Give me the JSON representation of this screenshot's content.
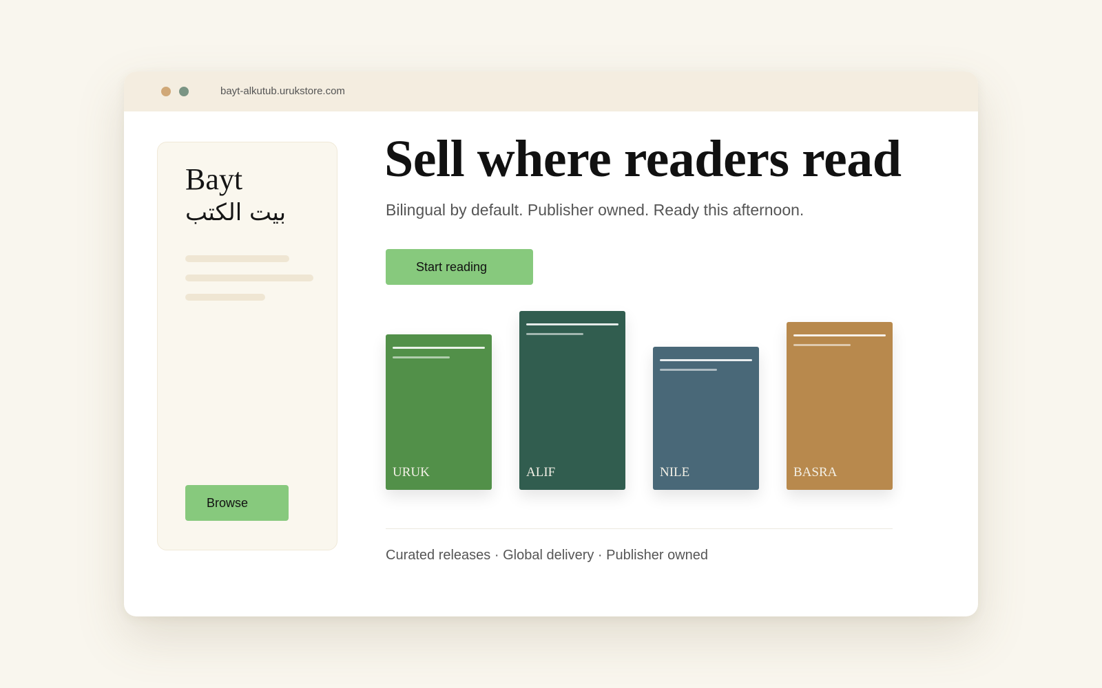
{
  "browser": {
    "url": "bayt-alkutub.urukstore.com",
    "dot_colors": [
      "#f4ede0",
      "#d0a878",
      "#7a9484"
    ]
  },
  "sidebar": {
    "brand": "Bayt",
    "brand_arabic": "بيت الكتب",
    "browse_label": "Browse"
  },
  "hero": {
    "headline": "Sell where readers read",
    "subline": "Bilingual by default. Publisher owned. Ready this afternoon.",
    "cta_label": "Start reading"
  },
  "books": [
    {
      "title": "URUK",
      "color": "#529049"
    },
    {
      "title": "ALIF",
      "color": "#315d4f"
    },
    {
      "title": "NILE",
      "color": "#496878"
    },
    {
      "title": "BASRA",
      "color": "#b8894d"
    }
  ],
  "footer": {
    "text": "Curated releases · Global delivery · Publisher owned"
  },
  "colors": {
    "accent": "#87c97d",
    "page_background": "#f9f6ee"
  }
}
